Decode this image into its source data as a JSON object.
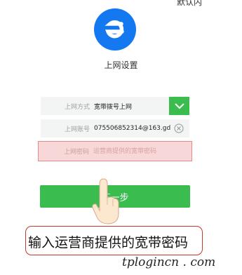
{
  "corner_text": "默认内",
  "app": {
    "title": "上网设置",
    "logo_letter": "e"
  },
  "form": {
    "mode_label": "上网方式",
    "mode_value": "宽带拨号上网",
    "account_label": "上网账号",
    "account_value": "075506852314@163.gd",
    "password_label": "上网密码",
    "password_placeholder": "运营商提供的宽带密码",
    "next_label": "下一步"
  },
  "callout": "输入运营商提供的宽带密码",
  "watermark": "tplogincn . com",
  "colors": {
    "brand_blue": "#1478f0",
    "accent_green": "#3bbc4f",
    "error_red": "#e68a8a"
  }
}
